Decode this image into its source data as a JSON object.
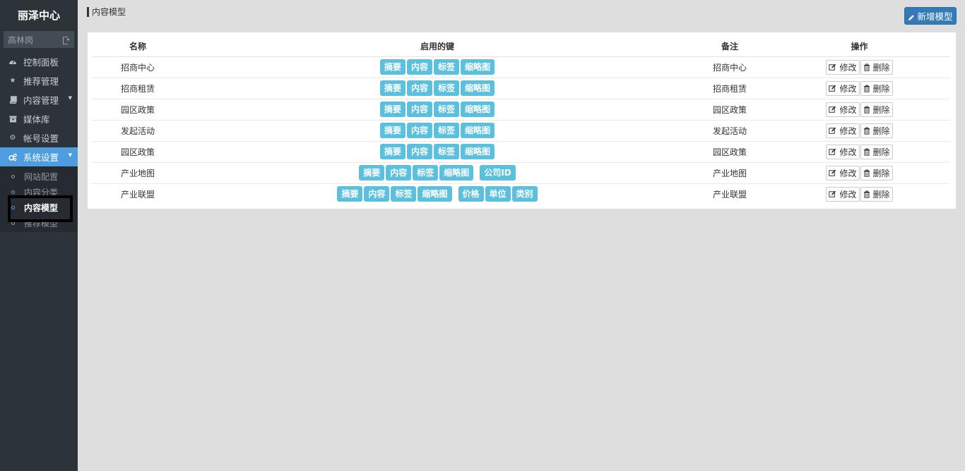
{
  "sidebar": {
    "brand": "丽泽中心",
    "user": "高林岗",
    "items": [
      {
        "label": "控制面板",
        "icon": "dashboard-icon"
      },
      {
        "label": "推荐管理",
        "icon": "star-icon"
      },
      {
        "label": "内容管理",
        "icon": "book-icon"
      },
      {
        "label": "媒体库",
        "icon": "media-icon"
      },
      {
        "label": "帐号设置",
        "icon": "gear-icon"
      },
      {
        "label": "系统设置",
        "icon": "gears-icon"
      }
    ],
    "submenu": [
      "网站配置",
      "内容分类",
      "内容模型",
      "推荐模型"
    ]
  },
  "header": {
    "title": "内容模型",
    "new_button": "新增模型"
  },
  "table": {
    "columns": [
      "名称",
      "启用的键",
      "备注",
      "操作"
    ],
    "actions": {
      "edit": "修改",
      "delete": "删除"
    },
    "rows": [
      {
        "name": "招商中心",
        "keys": [
          "摘要",
          "内容",
          "标签",
          "缩略图"
        ],
        "note": "招商中心"
      },
      {
        "name": "招商租赁",
        "keys": [
          "摘要",
          "内容",
          "标签",
          "缩略图"
        ],
        "note": "招商租赁"
      },
      {
        "name": "园区政策",
        "keys": [
          "摘要",
          "内容",
          "标签",
          "缩略图"
        ],
        "note": "园区政策"
      },
      {
        "name": "发起活动",
        "keys": [
          "摘要",
          "内容",
          "标签",
          "缩略图"
        ],
        "note": "发起活动"
      },
      {
        "name": "园区政策",
        "keys": [
          "摘要",
          "内容",
          "标签",
          "缩略图"
        ],
        "note": "园区政策"
      },
      {
        "name": "产业地图",
        "keys": [
          "摘要",
          "内容",
          "标签",
          "缩略图"
        ],
        "extra_keys": [
          "公司ID"
        ],
        "note": "产业地图"
      },
      {
        "name": "产业联盟",
        "keys": [
          "摘要",
          "内容",
          "标签",
          "缩略图"
        ],
        "extra_keys": [
          "价格",
          "单位",
          "类别"
        ],
        "note": "产业联盟"
      }
    ]
  },
  "colors": {
    "sidebar_bg": "#2c3339",
    "active_bg": "#4d9de0",
    "tag_bg": "#5bc0de",
    "primary_button": "#337ab7",
    "page_bg": "#dedede"
  }
}
